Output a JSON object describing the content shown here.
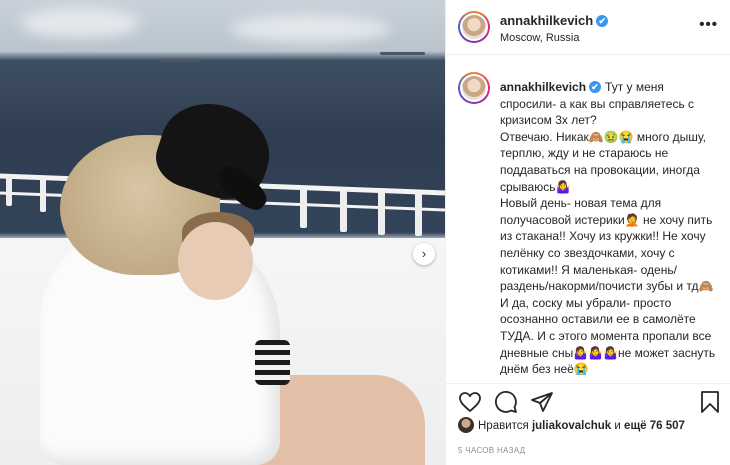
{
  "post": {
    "username": "annakhilkevich",
    "location": "Moscow, Russia",
    "verified_mark": "✔",
    "more_label": "•••",
    "carousel_next": "›",
    "caption": "Тут у меня спросили- а как вы справляетесь с кризисом 3х лет?\nОтвечаю. Никак🙈🤢😭 много дышу, терплю, жду и не стараюсь не поддаваться на провокации, иногда срываюсь🤷‍♀️\nНовый день- новая тема для получасовой истерики🤦 не хочу пить из стакана!! Хочу из кружки!! Не хочу пелёнку со звездочками, хочу с котиками!! Я маленькая- одень/раздень/накорми/почисти зубы и тд🙈\nИ да, соску мы убрали- просто осознанно оставили ее в самолёте ТУДА. И с этого момента пропали все дневные сны🤷‍♀️🤷‍♀️🤷‍♀️не может заснуть днём без неё😭",
    "likes_prefix": "Нравится ",
    "likes_user": "juliakovalchuk",
    "likes_middle": " и ",
    "likes_rest": "ещё 76 507",
    "time": "5 ЧАСОВ НАЗАД"
  },
  "icons": {
    "like": "heart-icon",
    "comment": "comment-icon",
    "share": "share-icon",
    "save": "bookmark-icon"
  }
}
